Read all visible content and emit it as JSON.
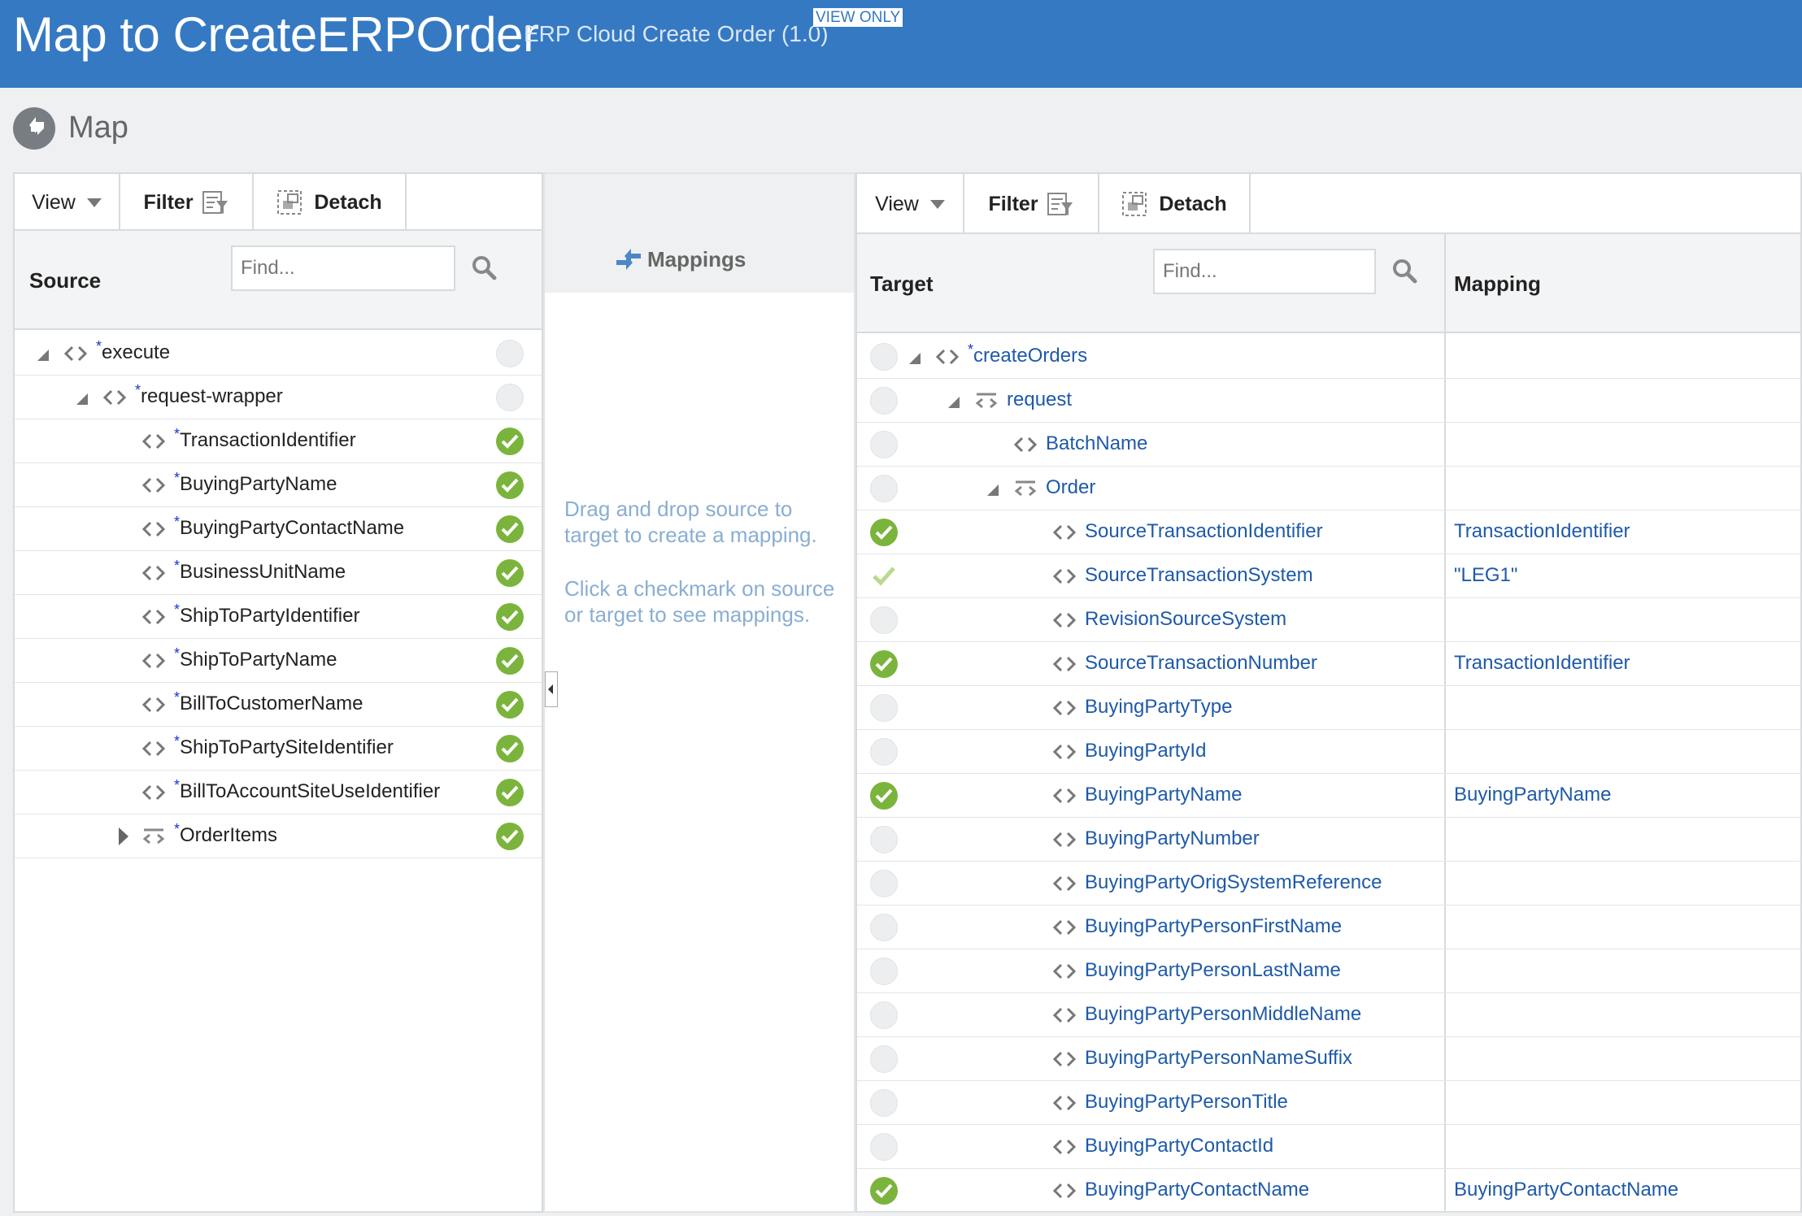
{
  "header": {
    "title": "Map to CreateERPOrder",
    "subtitle": "ERP Cloud Create Order (1.0)",
    "badge": "VIEW ONLY"
  },
  "map_section": {
    "label": "Map"
  },
  "source_panel": {
    "toolbar": {
      "view": "View",
      "filter": "Filter",
      "detach": "Detach"
    },
    "column": "Source",
    "find_placeholder": "Find...",
    "rows": [
      {
        "name": "execute",
        "required": "*",
        "status": "empty"
      },
      {
        "name": "request-wrapper",
        "required": "*",
        "status": "empty"
      },
      {
        "name": "TransactionIdentifier",
        "required": "*",
        "status": "mapped"
      },
      {
        "name": "BuyingPartyName",
        "required": "*",
        "status": "mapped"
      },
      {
        "name": "BuyingPartyContactName",
        "required": "*",
        "status": "mapped"
      },
      {
        "name": "BusinessUnitName",
        "required": "*",
        "status": "mapped"
      },
      {
        "name": "ShipToPartyIdentifier",
        "required": "*",
        "status": "mapped"
      },
      {
        "name": "ShipToPartyName",
        "required": "*",
        "status": "mapped"
      },
      {
        "name": "BillToCustomerName",
        "required": "*",
        "status": "mapped"
      },
      {
        "name": "ShipToPartySiteIdentifier",
        "required": "*",
        "status": "mapped"
      },
      {
        "name": "BillToAccountSiteUseIdentifier",
        "required": "*",
        "status": "mapped"
      },
      {
        "name": "OrderItems",
        "required": "*",
        "status": "mapped"
      }
    ]
  },
  "mappings_panel": {
    "title": "Mappings",
    "help_drag": "Drag and drop source to target to create a mapping.",
    "help_click": "Click a checkmark on source or target to see mappings."
  },
  "target_panel": {
    "toolbar": {
      "view": "View",
      "filter": "Filter",
      "detach": "Detach"
    },
    "column_target": "Target",
    "column_mapping": "Mapping",
    "find_placeholder": "Find...",
    "rows": [
      {
        "name": "createOrders",
        "required": "*",
        "status": "empty",
        "mapping": ""
      },
      {
        "name": "request",
        "required": "",
        "status": "empty",
        "mapping": ""
      },
      {
        "name": "BatchName",
        "required": "",
        "status": "empty",
        "mapping": ""
      },
      {
        "name": "Order",
        "required": "",
        "status": "empty",
        "mapping": ""
      },
      {
        "name": "SourceTransactionIdentifier",
        "required": "",
        "status": "mapped",
        "mapping": "TransactionIdentifier"
      },
      {
        "name": "SourceTransactionSystem",
        "required": "",
        "status": "literal",
        "mapping": "\"LEG1\""
      },
      {
        "name": "RevisionSourceSystem",
        "required": "",
        "status": "empty",
        "mapping": ""
      },
      {
        "name": "SourceTransactionNumber",
        "required": "",
        "status": "mapped",
        "mapping": "TransactionIdentifier"
      },
      {
        "name": "BuyingPartyType",
        "required": "",
        "status": "empty",
        "mapping": ""
      },
      {
        "name": "BuyingPartyId",
        "required": "",
        "status": "empty",
        "mapping": ""
      },
      {
        "name": "BuyingPartyName",
        "required": "",
        "status": "mapped",
        "mapping": "BuyingPartyName"
      },
      {
        "name": "BuyingPartyNumber",
        "required": "",
        "status": "empty",
        "mapping": ""
      },
      {
        "name": "BuyingPartyOrigSystemReference",
        "required": "",
        "status": "empty",
        "mapping": ""
      },
      {
        "name": "BuyingPartyPersonFirstName",
        "required": "",
        "status": "empty",
        "mapping": ""
      },
      {
        "name": "BuyingPartyPersonLastName",
        "required": "",
        "status": "empty",
        "mapping": ""
      },
      {
        "name": "BuyingPartyPersonMiddleName",
        "required": "",
        "status": "empty",
        "mapping": ""
      },
      {
        "name": "BuyingPartyPersonNameSuffix",
        "required": "",
        "status": "empty",
        "mapping": ""
      },
      {
        "name": "BuyingPartyPersonTitle",
        "required": "",
        "status": "empty",
        "mapping": ""
      },
      {
        "name": "BuyingPartyContactId",
        "required": "",
        "status": "empty",
        "mapping": ""
      },
      {
        "name": "BuyingPartyContactName",
        "required": "",
        "status": "mapped",
        "mapping": "BuyingPartyContactName"
      }
    ]
  },
  "colors": {
    "header_bg": "#3579c3",
    "mapped_green": "#7bb43c",
    "link_blue": "#1e5aa8"
  }
}
